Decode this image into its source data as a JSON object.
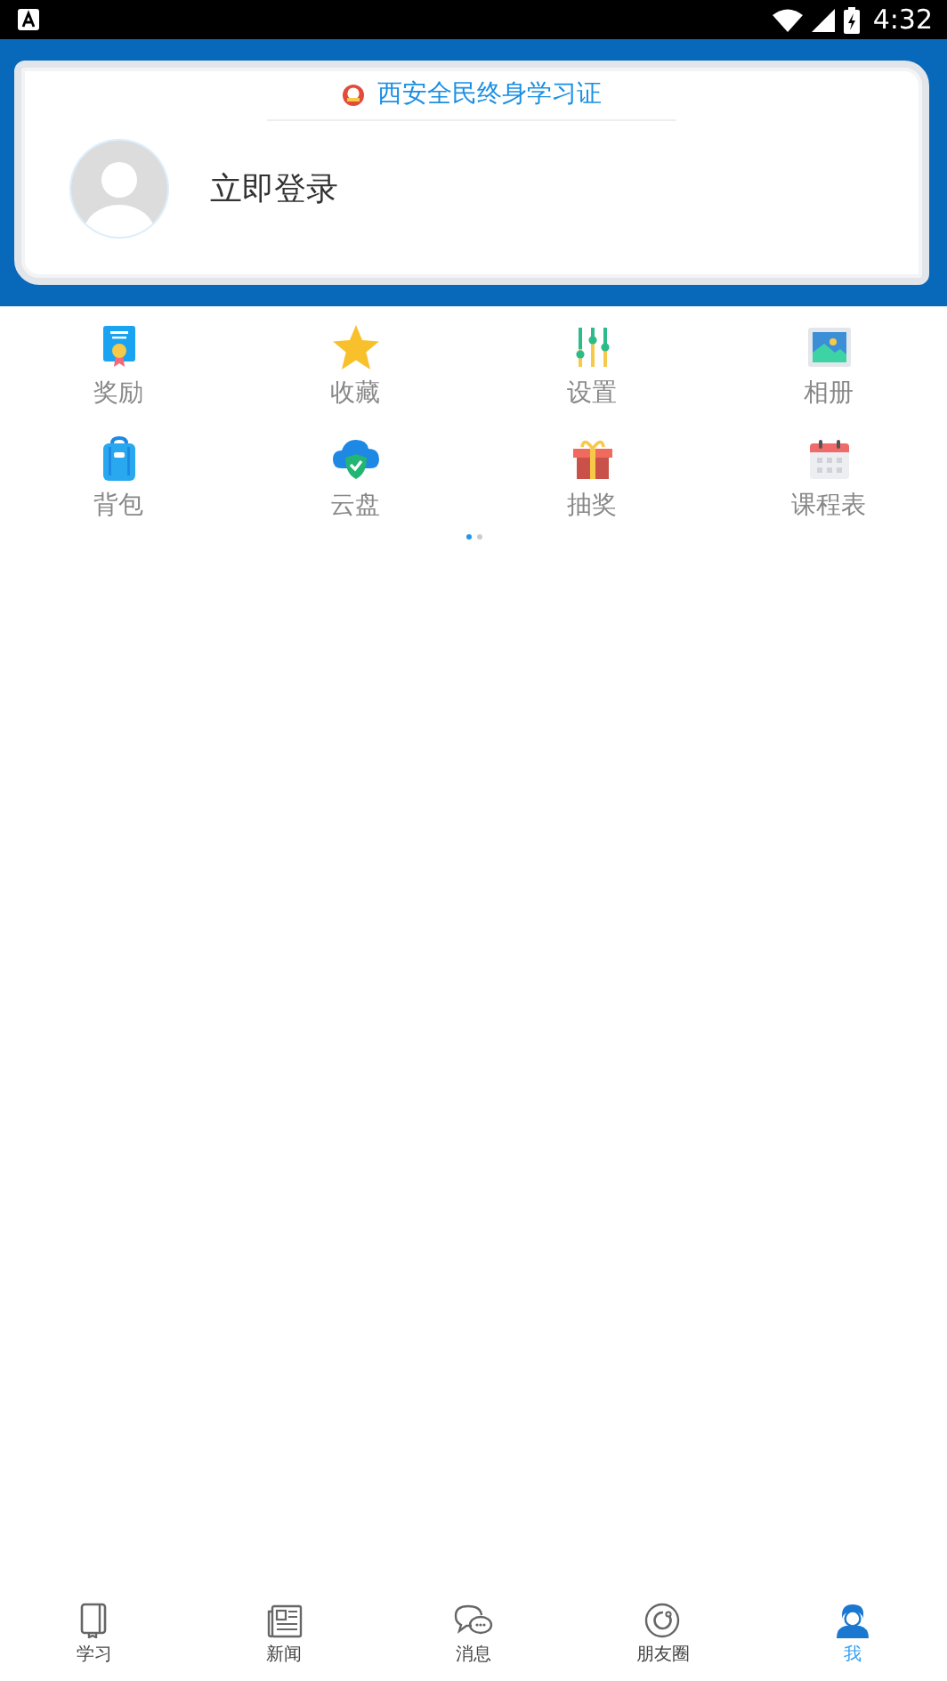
{
  "status_bar": {
    "time": "4:32"
  },
  "card": {
    "title": "西安全民终身学习证",
    "login": "立即登录"
  },
  "grid": [
    {
      "label": "奖励",
      "kind": "certificate"
    },
    {
      "label": "收藏",
      "kind": "star"
    },
    {
      "label": "设置",
      "kind": "sliders"
    },
    {
      "label": "相册",
      "kind": "photo"
    },
    {
      "label": "背包",
      "kind": "backpack"
    },
    {
      "label": "云盘",
      "kind": "cloud"
    },
    {
      "label": "抽奖",
      "kind": "gift"
    },
    {
      "label": "课程表",
      "kind": "calendar"
    }
  ],
  "pages": [
    {
      "selected": true
    },
    {
      "selected": false
    }
  ],
  "tabs": [
    {
      "label": "学习",
      "kind": "book",
      "selected": false
    },
    {
      "label": "新闻",
      "kind": "news",
      "selected": false
    },
    {
      "label": "消息",
      "kind": "chat",
      "selected": false
    },
    {
      "label": "朋友圈",
      "kind": "circle",
      "selected": false
    },
    {
      "label": "我",
      "kind": "person",
      "selected": true
    }
  ]
}
